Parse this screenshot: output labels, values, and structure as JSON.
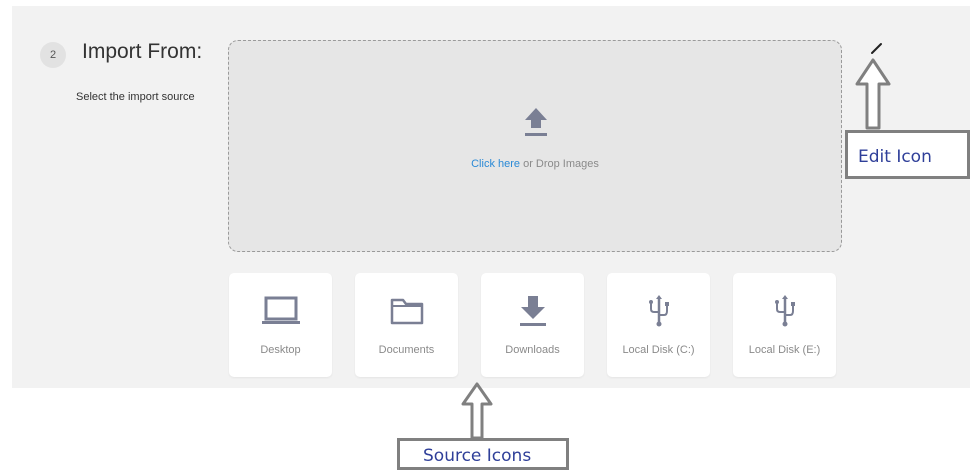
{
  "step_number": "2",
  "title": "Import From:",
  "subtitle": "Select the import source",
  "dropzone": {
    "link_text": "Click here",
    "rest_text": " or Drop Images"
  },
  "sources": [
    {
      "label": "Desktop",
      "icon": "laptop-icon"
    },
    {
      "label": "Documents",
      "icon": "folder-icon"
    },
    {
      "label": "Downloads",
      "icon": "download-icon"
    },
    {
      "label": "Local Disk (C:)",
      "icon": "usb-icon"
    },
    {
      "label": "Local Disk (E:)",
      "icon": "usb-icon"
    }
  ],
  "annotations": {
    "edit_label": "Edit Icon",
    "sources_label": "Source Icons"
  },
  "colors": {
    "link": "#2b8ad6",
    "icon": "#7a7f94",
    "callout_text": "#2f3f99",
    "callout_border": "#808080"
  }
}
